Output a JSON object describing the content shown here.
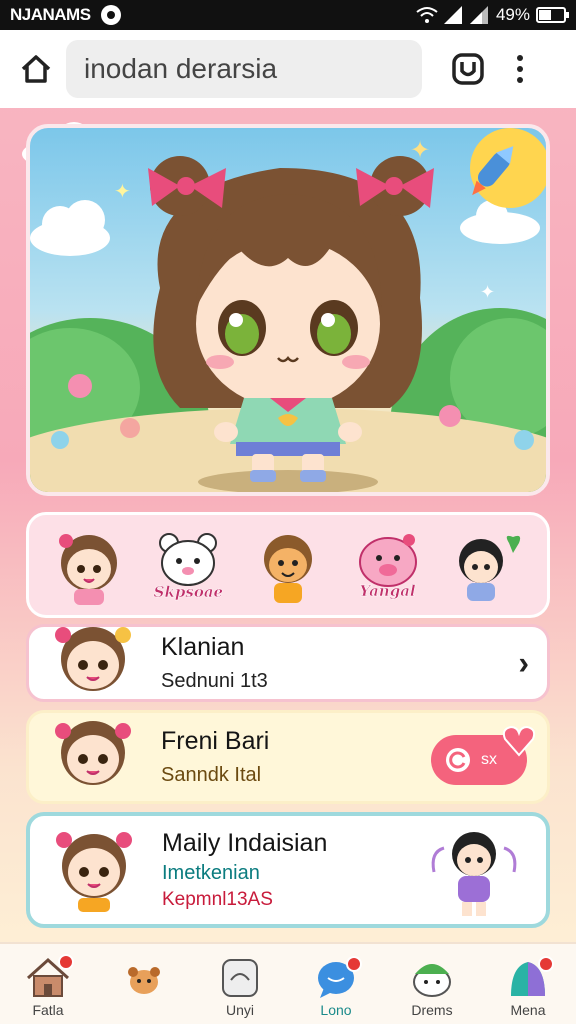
{
  "status_bar": {
    "carrier": "NJANAMS",
    "battery": "49%",
    "battery_level": 0.49
  },
  "browser": {
    "url": "inodan derarsia"
  },
  "sticker_row": {
    "items": [
      {
        "icon": "girl-sticker",
        "caption": ""
      },
      {
        "icon": "bear-sticker",
        "caption": "Skpsoae"
      },
      {
        "icon": "boy-sticker",
        "caption": ""
      },
      {
        "icon": "pig-sticker",
        "caption": "Yangal"
      },
      {
        "icon": "kid-heart-sticker",
        "caption": ""
      }
    ]
  },
  "cards": [
    {
      "title": "Klanian",
      "subtitle": "Sednuni 1t3"
    },
    {
      "title": "Freni Bari",
      "subtitle": "Sanndk Ital",
      "pill_text": "sx"
    },
    {
      "title": "Maily Indaisian",
      "subtitle": "Imetkenian",
      "subtitle2": "Kepmnl13AS"
    }
  ],
  "bottom_nav": {
    "items": [
      {
        "label": "Fatla",
        "icon": "house-icon",
        "badge": true
      },
      {
        "label": "",
        "icon": "puppy-icon",
        "badge": false
      },
      {
        "label": "Unyi",
        "icon": "sticker-icon",
        "badge": false
      },
      {
        "label": "Lono",
        "icon": "chat-bubble-icon",
        "badge": true
      },
      {
        "label": "Drems",
        "icon": "frog-icon",
        "badge": false
      },
      {
        "label": "Mena",
        "icon": "puzzle-icon",
        "badge": true
      }
    ]
  },
  "colors": {
    "accent": "#f4637d",
    "hero_border": "#fbe8ec",
    "card3_border": "#9ed9dd"
  }
}
